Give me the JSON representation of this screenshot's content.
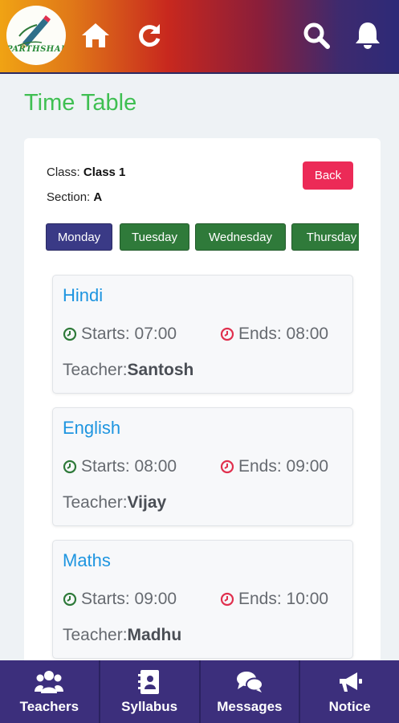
{
  "app": {
    "logo_text": "PARTHSHALA"
  },
  "header": {
    "icons": [
      "home-icon",
      "refresh-icon",
      "search-icon",
      "bell-icon"
    ]
  },
  "page": {
    "title": "Time Table"
  },
  "info": {
    "class_label": "Class:",
    "class_value": "Class 1",
    "section_label": "Section:",
    "section_value": "A",
    "back_label": "Back"
  },
  "days": [
    {
      "label": "Monday",
      "active": true
    },
    {
      "label": "Tuesday",
      "active": false
    },
    {
      "label": "Wednesday",
      "active": false
    },
    {
      "label": "Thursday",
      "active": false
    }
  ],
  "periods": [
    {
      "subject": "Hindi",
      "starts": "Starts: 07:00",
      "ends": "Ends: 08:00",
      "teacher_label": "Teacher:",
      "teacher": "Santosh"
    },
    {
      "subject": "English",
      "starts": "Starts: 08:00",
      "ends": "Ends: 09:00",
      "teacher_label": "Teacher:",
      "teacher": "Vijay"
    },
    {
      "subject": "Maths",
      "starts": "Starts: 09:00",
      "ends": "Ends: 10:00",
      "teacher_label": "Teacher:",
      "teacher": "Madhu"
    }
  ],
  "bottom_nav": [
    {
      "label": "Teachers",
      "icon": "users-icon"
    },
    {
      "label": "Syllabus",
      "icon": "contact-book-icon"
    },
    {
      "label": "Messages",
      "icon": "chat-icon"
    },
    {
      "label": "Notice",
      "icon": "megaphone-icon"
    }
  ],
  "colors": {
    "title_green": "#3fbf52",
    "subject_blue": "#1e95e0",
    "back_red": "#ec2a57",
    "day_active": "#3a3a86",
    "day_inactive": "#2f7a3a",
    "nav_bg": "#3c2f7c",
    "start_icon": "#2f7a3a",
    "end_icon": "#e0304e"
  }
}
